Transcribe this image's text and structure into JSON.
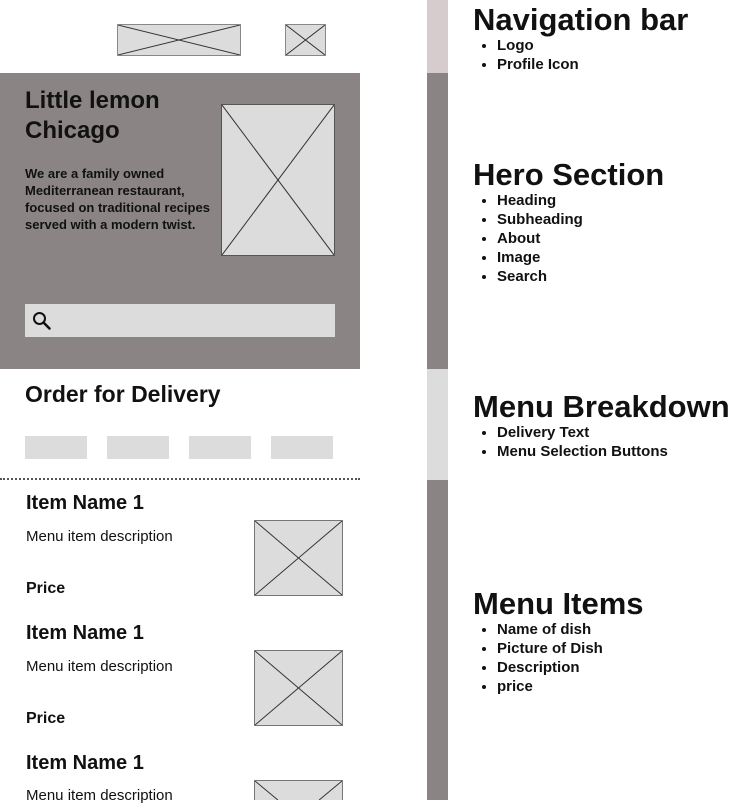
{
  "wireframe": {
    "hero": {
      "title": "Little lemon Chicago",
      "description": "We are a family owned Mediterranean restaurant, focused on traditional recipes served with a modern twist."
    },
    "delivery": {
      "heading": "Order for Delivery"
    },
    "menu_items": [
      {
        "name": "Item Name 1",
        "description": "Menu item description",
        "price": "Price"
      },
      {
        "name": "Item Name 1",
        "description": "Menu item description",
        "price": "Price"
      },
      {
        "name": "Item Name 1",
        "description": "Menu item description"
      }
    ]
  },
  "annotations": [
    {
      "title": "Navigation bar",
      "items": [
        "Logo",
        "Profile Icon"
      ]
    },
    {
      "title": "Hero Section",
      "items": [
        "Heading",
        "Subheading",
        "About",
        "Image",
        "Search"
      ]
    },
    {
      "title": "Menu Breakdown",
      "items": [
        "Delivery Text",
        "Menu Selection Buttons"
      ]
    },
    {
      "title": "Menu Items",
      "items": [
        "Name of dish",
        "Picture of Dish",
        "Description",
        "price"
      ]
    }
  ],
  "colors": {
    "hero_background": "#8a8484",
    "placeholder": "#dcdcdc",
    "bar_navigation": "#d7cccd",
    "bar_hero": "#8a8484",
    "bar_menu_breakdown": "#dcdcdc",
    "bar_menu_items": "#8a8484"
  },
  "icons": {
    "search": "search-icon"
  }
}
